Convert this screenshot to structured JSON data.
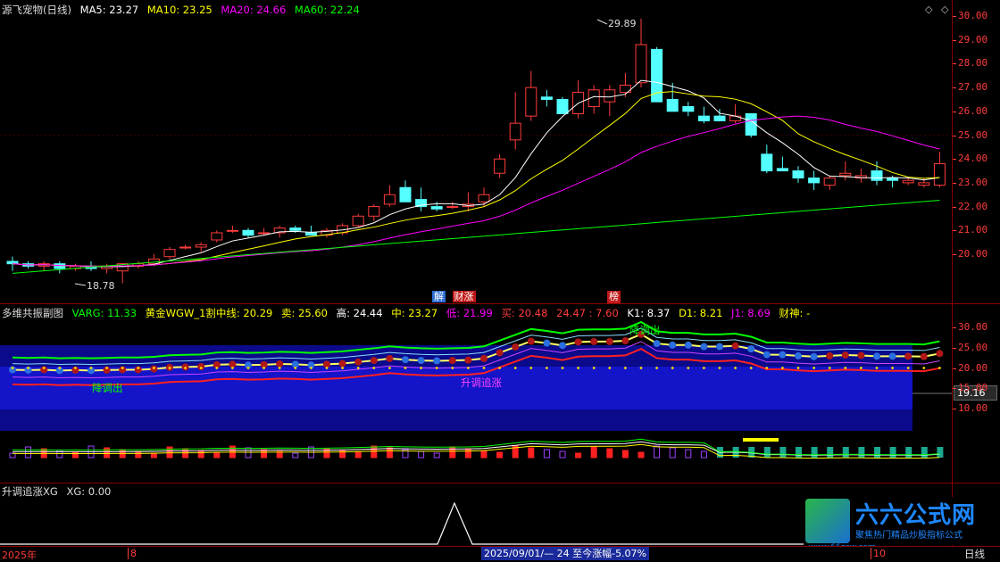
{
  "main": {
    "stock_title": "源飞宠物(日线)",
    "ma": [
      {
        "label": "MA5: 23.27",
        "color": "#ffffff"
      },
      {
        "label": "MA10: 23.25",
        "color": "#ffff00"
      },
      {
        "label": "MA20: 24.66",
        "color": "#ff00ff"
      },
      {
        "label": "MA60: 22.24",
        "color": "#00ff00"
      }
    ],
    "high_label": "29.89",
    "low_label": "18.78",
    "price_ticks": [
      "30.00",
      "29.00",
      "28.00",
      "27.00",
      "26.00",
      "25.00",
      "24.00",
      "23.00",
      "22.00",
      "21.00",
      "20.00"
    ],
    "markers": [
      {
        "text": "解",
        "bg": "#2f6fd6"
      },
      {
        "text": "财涨",
        "bg": "#c01818"
      },
      {
        "text": "榜",
        "bg": "#c01818"
      }
    ],
    "candles": [
      [
        19.7,
        19.9,
        19.3,
        19.6
      ],
      [
        19.6,
        19.7,
        19.4,
        19.5
      ],
      [
        19.5,
        19.7,
        19.3,
        19.6
      ],
      [
        19.6,
        19.7,
        19.2,
        19.4
      ],
      [
        19.4,
        19.6,
        19.3,
        19.5
      ],
      [
        19.5,
        19.7,
        19.3,
        19.4
      ],
      [
        19.4,
        19.6,
        19.2,
        19.5
      ],
      [
        19.3,
        19.6,
        18.78,
        19.6
      ],
      [
        19.5,
        19.7,
        19.4,
        19.6
      ],
      [
        19.6,
        20.0,
        19.5,
        19.8
      ],
      [
        19.9,
        20.3,
        19.8,
        20.2
      ],
      [
        20.3,
        20.4,
        20.2,
        20.3
      ],
      [
        20.3,
        20.5,
        20.1,
        20.4
      ],
      [
        20.6,
        21.0,
        20.5,
        20.9
      ],
      [
        21.0,
        21.2,
        20.9,
        21.0
      ],
      [
        21.0,
        21.1,
        20.7,
        20.8
      ],
      [
        20.9,
        21.1,
        20.8,
        20.9
      ],
      [
        20.9,
        21.2,
        20.7,
        21.1
      ],
      [
        21.1,
        21.2,
        20.9,
        21.0
      ],
      [
        20.9,
        21.2,
        20.8,
        20.8
      ],
      [
        20.8,
        21.1,
        20.7,
        21.0
      ],
      [
        20.9,
        21.3,
        20.8,
        21.2
      ],
      [
        21.2,
        21.7,
        21.1,
        21.6
      ],
      [
        21.6,
        22.1,
        21.4,
        22.0
      ],
      [
        22.1,
        22.9,
        22.0,
        22.5
      ],
      [
        22.8,
        23.1,
        22.3,
        22.2
      ],
      [
        22.3,
        22.8,
        21.8,
        22.0
      ],
      [
        22.0,
        22.2,
        21.8,
        21.9
      ],
      [
        22.0,
        22.2,
        21.9,
        22.0
      ],
      [
        22.0,
        22.6,
        21.8,
        22.1
      ],
      [
        22.2,
        22.8,
        22.0,
        22.5
      ],
      [
        23.4,
        24.2,
        23.2,
        24.0
      ],
      [
        24.8,
        26.8,
        24.4,
        25.5
      ],
      [
        25.8,
        27.7,
        25.6,
        27.0
      ],
      [
        26.6,
        26.9,
        26.2,
        26.5
      ],
      [
        26.5,
        26.6,
        25.9,
        25.9
      ],
      [
        25.9,
        27.3,
        25.7,
        26.8
      ],
      [
        26.2,
        27.1,
        25.9,
        26.9
      ],
      [
        26.4,
        27.1,
        25.8,
        26.9
      ],
      [
        26.8,
        27.6,
        26.6,
        27.1
      ],
      [
        27.2,
        29.89,
        27.0,
        28.8
      ],
      [
        28.6,
        28.7,
        26.5,
        26.4
      ],
      [
        26.5,
        27.2,
        26.1,
        26.0
      ],
      [
        26.2,
        26.4,
        25.8,
        26.0
      ],
      [
        25.8,
        26.2,
        25.5,
        25.6
      ],
      [
        25.8,
        26.1,
        25.6,
        25.6
      ],
      [
        25.6,
        26.3,
        25.5,
        25.8
      ],
      [
        25.9,
        25.9,
        24.9,
        25.0
      ],
      [
        24.2,
        24.6,
        23.4,
        23.5
      ],
      [
        23.6,
        24.1,
        23.5,
        23.5
      ],
      [
        23.5,
        23.7,
        23.0,
        23.2
      ],
      [
        23.2,
        23.5,
        22.7,
        23.0
      ],
      [
        22.9,
        23.3,
        22.7,
        23.2
      ],
      [
        23.3,
        23.9,
        23.1,
        23.4
      ],
      [
        23.2,
        23.6,
        23.0,
        23.3
      ],
      [
        23.5,
        23.9,
        22.9,
        23.1
      ],
      [
        23.2,
        23.3,
        22.8,
        23.1
      ],
      [
        23.0,
        23.2,
        22.9,
        23.1
      ],
      [
        22.9,
        23.2,
        22.8,
        23.0
      ],
      [
        22.9,
        24.3,
        22.8,
        23.8
      ]
    ]
  },
  "sub1": {
    "title": "多维共振副图",
    "indicators": [
      {
        "label": "VARG: 11.33",
        "color": "#00ff00"
      },
      {
        "label": "黄金WGW_1割中线: 20.29",
        "color": "#ffff00"
      },
      {
        "label": "卖: 25.60",
        "color": "#ffff00"
      },
      {
        "label": "高: 24.44",
        "color": "#ffffff"
      },
      {
        "label": "中: 23.27",
        "color": "#ffff00"
      },
      {
        "label": "低: 21.99",
        "color": "#ff00ff"
      },
      {
        "label": "买: 20.48",
        "color": "#ff3c3c"
      },
      {
        "label": "24.47 : 7.60",
        "color": "#ff3c3c"
      },
      {
        "label": "K1: 8.37",
        "color": "#ffffff"
      },
      {
        "label": "D1: 8.21",
        "color": "#ffff00"
      },
      {
        "label": "J1: 8.69",
        "color": "#ff00ff"
      },
      {
        "label": "财神: -",
        "color": "#ffff00"
      }
    ],
    "ticks": [
      "30.00",
      "25.00",
      "20.00",
      "15.00",
      "10.00"
    ],
    "badge": "19.16",
    "annotations": [
      "降调出",
      "降调出",
      "升调追涨"
    ]
  },
  "sub2": {
    "title": "升调追涨XG",
    "value_label": "XG: 0.00"
  },
  "statusbar": {
    "year": "2025年",
    "month": "8",
    "range_info": "2025/09/01/— 24 至今涨幅-5.07%",
    "month2": "10",
    "period": "日线"
  },
  "watermark": {
    "brand": "六六公式网",
    "slogan": "聚焦热门精品炒股指标公式",
    "url": "www.66gsw.com"
  },
  "colors": {
    "up": "#ff3c3c",
    "down": "#54ffff",
    "grid": "#8b0000"
  }
}
